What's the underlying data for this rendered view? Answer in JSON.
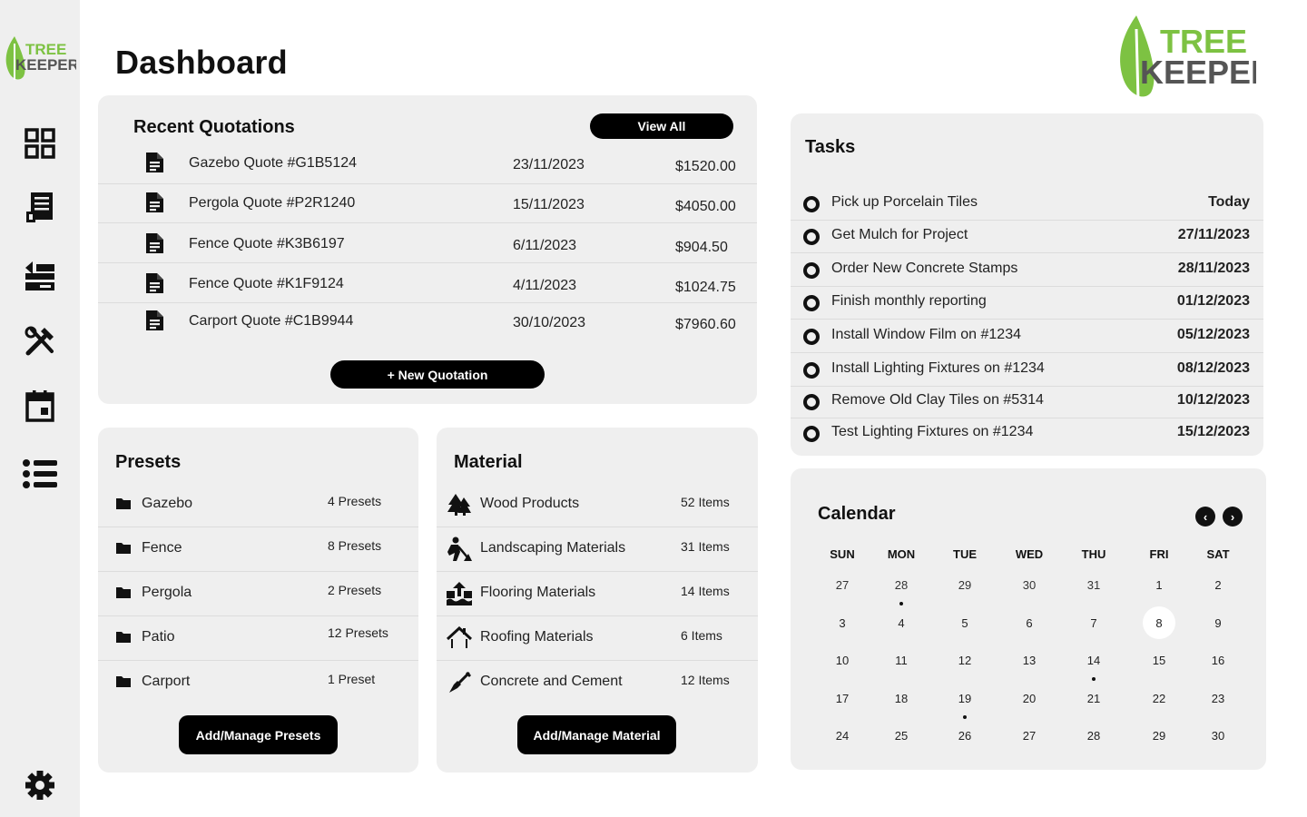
{
  "brand": {
    "logo_line1": "TREE",
    "logo_line2": "KEEPERS",
    "primary": "#7dc242",
    "dark": "#555555"
  },
  "sidebar": {
    "items": [
      {
        "icon": "dashboard-icon"
      },
      {
        "icon": "quotation-icon"
      },
      {
        "icon": "presets-icon"
      },
      {
        "icon": "tools-icon"
      },
      {
        "icon": "calendar-icon"
      },
      {
        "icon": "list-icon"
      }
    ],
    "settings_icon": "gear-icon"
  },
  "page": {
    "title": "Dashboard"
  },
  "quotations": {
    "title": "Recent Quotations",
    "view_all": "View All",
    "new_button": "+ New Quotation",
    "rows": [
      {
        "name": "Gazebo Quote #G1B5124",
        "date": "23/11/2023",
        "amount": "$1520.00"
      },
      {
        "name": "Pergola Quote #P2R1240",
        "date": "15/11/2023",
        "amount": "$4050.00"
      },
      {
        "name": "Fence Quote #K3B6197",
        "date": "6/11/2023",
        "amount": "$904.50"
      },
      {
        "name": "Fence Quote #K1F9124",
        "date": "4/11/2023",
        "amount": "$1024.75"
      },
      {
        "name": "Carport Quote #C1B9944",
        "date": "30/10/2023",
        "amount": "$7960.60"
      }
    ]
  },
  "presets": {
    "title": "Presets",
    "button": "Add/Manage Presets",
    "rows": [
      {
        "name": "Gazebo",
        "count": "4 Presets"
      },
      {
        "name": "Fence",
        "count": "8 Presets"
      },
      {
        "name": "Pergola",
        "count": "2 Presets"
      },
      {
        "name": "Patio",
        "count": "12 Presets"
      },
      {
        "name": "Carport",
        "count": "1 Preset"
      }
    ]
  },
  "material": {
    "title": "Material",
    "button": "Add/Manage Material",
    "rows": [
      {
        "name": "Wood Products",
        "count": "52 Items",
        "icon": "trees-icon"
      },
      {
        "name": "Landscaping Materials",
        "count": "31 Items",
        "icon": "digging-icon"
      },
      {
        "name": "Flooring Materials",
        "count": "14 Items",
        "icon": "flooring-icon"
      },
      {
        "name": "Roofing Materials",
        "count": "6 Items",
        "icon": "roof-icon"
      },
      {
        "name": "Concrete and Cement",
        "count": "12 Items",
        "icon": "trowel-icon"
      }
    ]
  },
  "tasks": {
    "title": "Tasks",
    "rows": [
      {
        "name": "Pick up Porcelain Tiles",
        "due": "Today"
      },
      {
        "name": "Get Mulch for Project",
        "due": "27/11/2023"
      },
      {
        "name": "Order New Concrete Stamps",
        "due": "28/11/2023"
      },
      {
        "name": "Finish monthly reporting",
        "due": "01/12/2023"
      },
      {
        "name": "Install Window Film on #1234",
        "due": "05/12/2023"
      },
      {
        "name": "Install Lighting Fixtures on #1234",
        "due": "08/12/2023"
      },
      {
        "name": "Remove Old Clay Tiles on #5314",
        "due": "10/12/2023"
      },
      {
        "name": "Test Lighting Fixtures on #1234",
        "due": "15/12/2023"
      }
    ]
  },
  "calendar": {
    "title": "Calendar",
    "prev": "‹",
    "next": "›",
    "weekdays": [
      "SUN",
      "MON",
      "TUE",
      "WED",
      "THU",
      "FRI",
      "SAT"
    ],
    "weeks": [
      [
        "27",
        "28",
        "29",
        "30",
        "31",
        "1",
        "2"
      ],
      [
        "3",
        "4",
        "5",
        "6",
        "7",
        "8",
        "9"
      ],
      [
        "10",
        "11",
        "12",
        "13",
        "14",
        "15",
        "16"
      ],
      [
        "17",
        "18",
        "19",
        "20",
        "21",
        "22",
        "23"
      ],
      [
        "24",
        "25",
        "26",
        "27",
        "28",
        "29",
        "30"
      ]
    ],
    "today": "8",
    "event_days": [
      "28",
      "14",
      "19"
    ]
  }
}
